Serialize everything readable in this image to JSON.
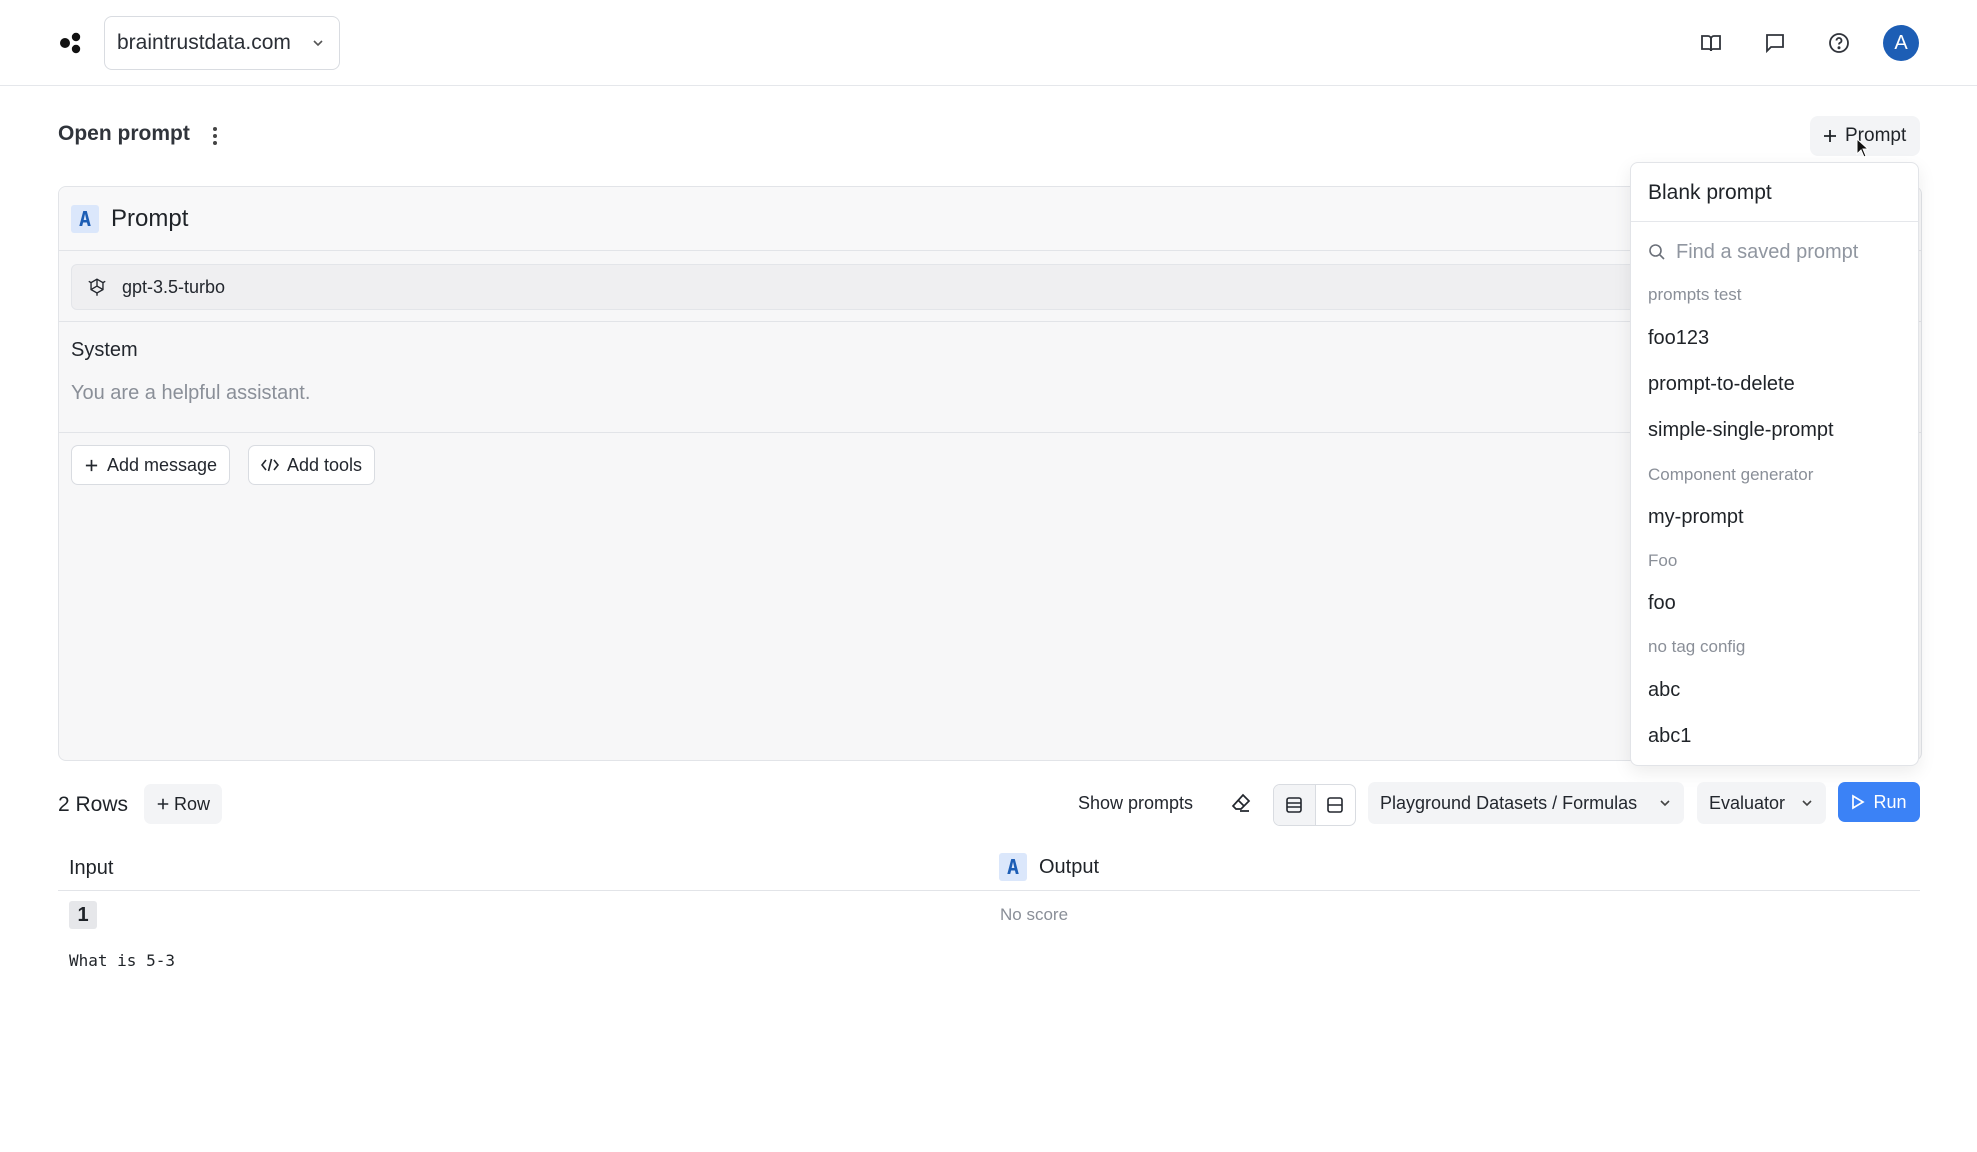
{
  "topbar": {
    "org_name": "braintrustdata.com",
    "avatar_initial": "A"
  },
  "header": {
    "title": "Open prompt",
    "add_prompt_label": "Prompt"
  },
  "prompt_card": {
    "badge": "A",
    "title": "Prompt",
    "model": "gpt-3.5-turbo",
    "system_label": "System",
    "system_placeholder": "You are a helpful assistant.",
    "add_message_label": "Add message",
    "add_tools_label": "Add tools"
  },
  "dropdown": {
    "blank_prompt": "Blank prompt",
    "search_placeholder": "Find a saved prompt",
    "groups": [
      {
        "name": "prompts test",
        "items": [
          "foo123",
          "prompt-to-delete",
          "simple-single-prompt"
        ]
      },
      {
        "name": "Component generator",
        "items": [
          "my-prompt"
        ]
      },
      {
        "name": "Foo",
        "items": [
          "foo"
        ]
      },
      {
        "name": "no tag config",
        "items": [
          "abc",
          "abc1"
        ]
      }
    ]
  },
  "rows_toolbar": {
    "rows_count": "2 Rows",
    "add_row_label": "Row",
    "show_prompts": "Show prompts",
    "dataset_select": "Playground Datasets / Formulas",
    "evaluator_select": "Evaluator",
    "run_label": "Run"
  },
  "table": {
    "col_input": "Input",
    "col_output_badge": "A",
    "col_output": "Output",
    "rows": [
      {
        "num": "1",
        "input": "What is 5-3",
        "output": "No score"
      }
    ]
  },
  "colors": {
    "accent": "#3b82f6",
    "avatar": "#1d5eb5",
    "badge_bg": "#dbe7fb"
  }
}
